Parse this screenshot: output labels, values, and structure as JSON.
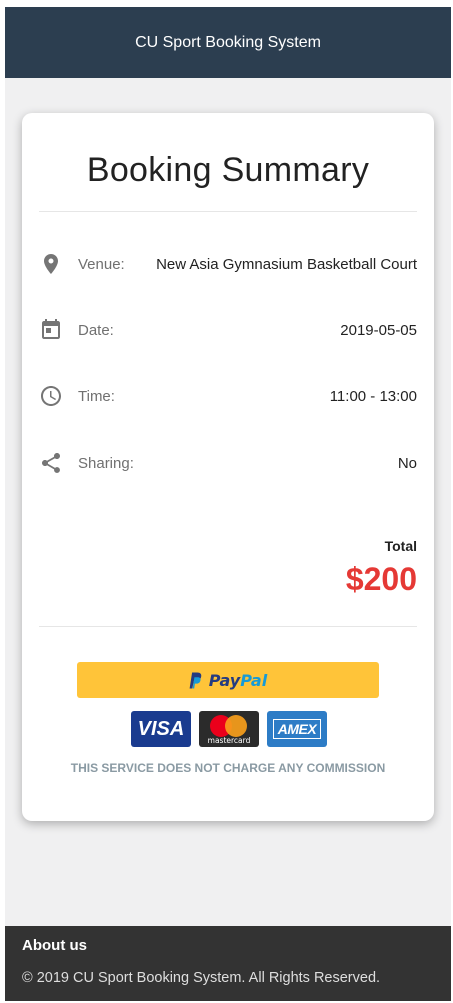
{
  "header": {
    "title": "CU Sport Booking System"
  },
  "summary": {
    "title": "Booking Summary",
    "rows": [
      {
        "icon": "location-pin-icon",
        "label": "Venue:",
        "value": "New Asia Gymnasium Basketball Court"
      },
      {
        "icon": "calendar-icon",
        "label": "Date:",
        "value": "2019-05-05"
      },
      {
        "icon": "clock-icon",
        "label": "Time:",
        "value": "11:00 - 13:00"
      },
      {
        "icon": "share-icon",
        "label": "Sharing:",
        "value": "No"
      }
    ],
    "total_label": "Total",
    "total_value": "$200"
  },
  "payment": {
    "paypal_part1": "Pay",
    "paypal_part2": "Pal",
    "cards": {
      "visa": "VISA",
      "mastercard": "mastercard",
      "amex": "AMEX"
    },
    "commission_note": "THIS SERVICE DOES NOT CHARGE ANY COMMISSION"
  },
  "footer": {
    "about": "About us",
    "copyright": "© 2019 CU Sport Booking System. All Rights Reserved."
  },
  "colors": {
    "header_bg": "#2c3e50",
    "total_red": "#e53935",
    "paypal_yellow": "#ffc439",
    "footer_bg": "#333333"
  }
}
